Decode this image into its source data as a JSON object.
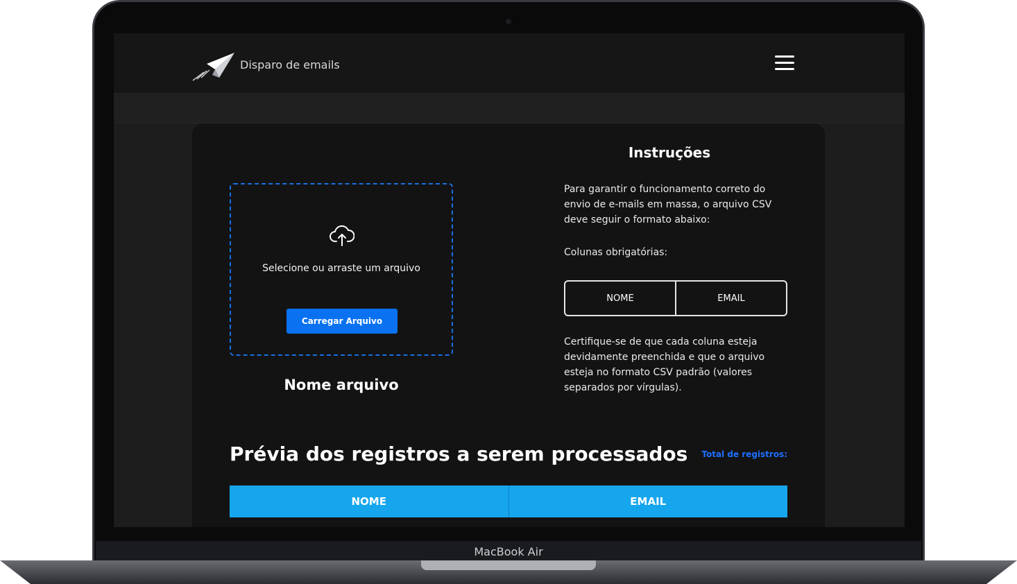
{
  "device": {
    "label": "MacBook Air"
  },
  "header": {
    "logo_icon": "paper-plane-icon",
    "title": "Disparo de emails",
    "menu_icon": "hamburger-icon"
  },
  "upload": {
    "icon": "cloud-upload-icon",
    "prompt": "Selecione ou arraste um arquivo",
    "button_label": "Carregar Arquivo",
    "file_name": "Nome arquivo",
    "accent_color": "#0a72f0"
  },
  "instructions": {
    "title": "Instruções",
    "intro": "Para garantir o funcionamento correto do envio de e-mails em massa, o arquivo CSV deve seguir o formato abaixo:",
    "columns_label": "Colunas obrigatórias:",
    "columns": [
      "NOME",
      "EMAIL"
    ],
    "note": "Certifique-se de que cada coluna esteja devidamente preenchida e que o arquivo esteja no formato CSV padrão (valores separados por vírgulas)."
  },
  "preview": {
    "title": "Prévia dos registros a serem processados",
    "total_label": "Total de registros:",
    "columns": [
      "NOME",
      "EMAIL"
    ],
    "header_color": "#16a6ee"
  }
}
